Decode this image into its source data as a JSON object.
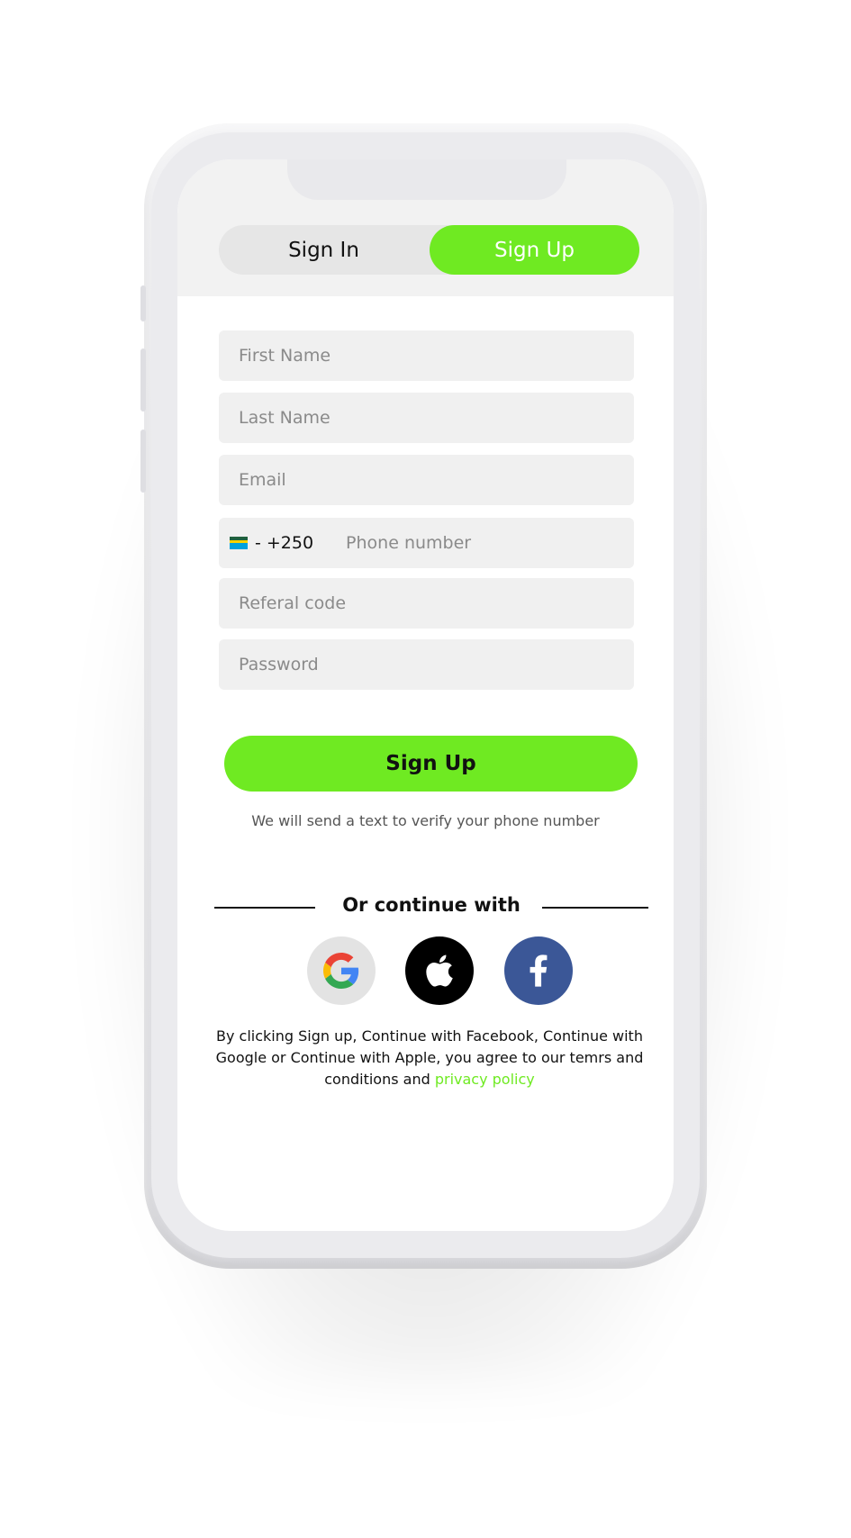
{
  "tabs": {
    "sign_in": "Sign In",
    "sign_up": "Sign Up"
  },
  "form": {
    "first_name_placeholder": "First Name",
    "last_name_placeholder": "Last Name",
    "email_placeholder": "Email",
    "country_code": "- +250",
    "phone_placeholder": "Phone number",
    "referral_placeholder": "Referal code",
    "password_placeholder": "Password",
    "submit_label": "Sign Up",
    "hint": "We will send a text to verify your phone number"
  },
  "social": {
    "divider_label": "Or continue with",
    "providers": [
      "google",
      "apple",
      "facebook"
    ]
  },
  "legal": {
    "text": "By clicking Sign up, Continue with Facebook, Continue with Google or Continue with Apple, you agree to our temrs and conditions and ",
    "link": "privacy policy"
  },
  "colors": {
    "accent": "#6fea22",
    "facebook": "#3b5797",
    "apple": "#000000",
    "google_bg": "#e3e3e3"
  },
  "icons": {
    "flag": "rwanda-flag-icon",
    "google": "google-icon",
    "apple": "apple-icon",
    "facebook": "facebook-icon"
  }
}
